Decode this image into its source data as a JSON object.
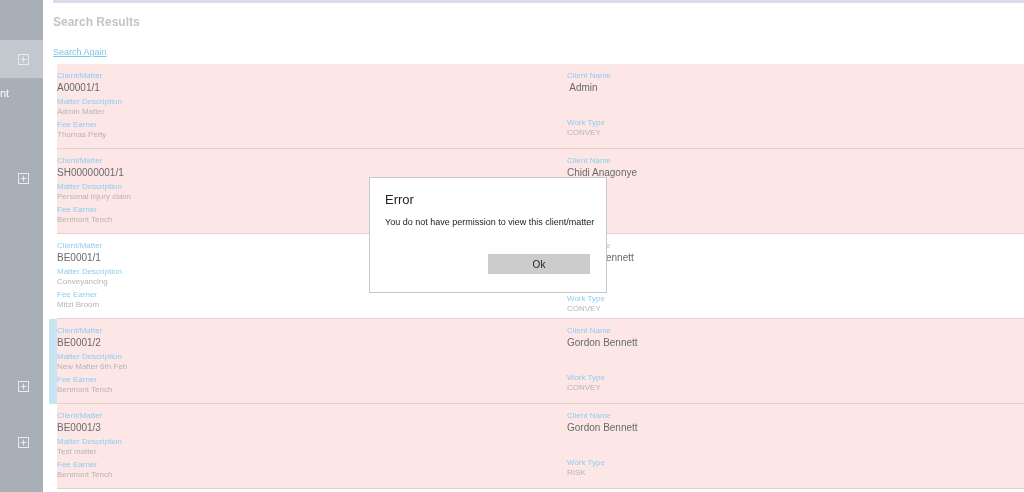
{
  "sidebar": {
    "items": [
      {
        "kind": "expander",
        "selected": true
      },
      {
        "kind": "text",
        "label": "nt"
      },
      {
        "kind": "expander",
        "selected": false
      },
      {
        "kind": "expander",
        "selected": false
      },
      {
        "kind": "expander",
        "selected": false
      }
    ]
  },
  "title": "Search Results",
  "search_again_link": "Search Again",
  "results": [
    {
      "selected": false,
      "highlighted": true,
      "partly_covered": false,
      "client_matter_label": "Client/Matter",
      "client_matter": "A00001/1",
      "matter_description_label": "Matter Description",
      "matter_description": "Admin Matter",
      "fee_earner_label": "Fee Earner",
      "fee_earner": "Thomas Petty",
      "client_name_label": "Client Name",
      "client_name": " Admin",
      "work_type_label": "Work Type",
      "work_type": "CONVEY"
    },
    {
      "selected": false,
      "highlighted": true,
      "partly_covered": false,
      "client_matter_label": "Client/Matter",
      "client_matter": "SH00000001/1",
      "matter_description_label": "Matter Description",
      "matter_description": "Personal injury claim",
      "fee_earner_label": "Fee Earner",
      "fee_earner": "Benmont Tench",
      "client_name_label": "Client Name",
      "client_name": "Chidi Anagonye"
    },
    {
      "selected": false,
      "highlighted": false,
      "partly_covered": true,
      "client_matter_label": "Client/Matter",
      "client_matter": "BE0001/1",
      "matter_description_label": "Matter Description",
      "matter_description": "Conveyancing",
      "fee_earner_label": "Fee Earner",
      "fee_earner": "Mitzi Broom",
      "client_name_label": "e",
      "client_name": "ennett",
      "work_type_label": "Work Type",
      "work_type": "CONVEY"
    },
    {
      "selected": true,
      "highlighted": true,
      "partly_covered": false,
      "client_matter_label": "Client/Matter",
      "client_matter": "BE0001/2",
      "matter_description_label": "Matter Description",
      "matter_description": "New Matter 6th Feb",
      "fee_earner_label": "Fee Earner",
      "fee_earner": "Benmont Tench",
      "client_name_label": "Client Name",
      "client_name": "Gordon Bennett",
      "work_type_label": "Work Type",
      "work_type": "CONVEY"
    },
    {
      "selected": false,
      "highlighted": true,
      "partly_covered": false,
      "client_matter_label": "Client/Matter",
      "client_matter": "BE0001/3",
      "matter_description_label": "Matter Description",
      "matter_description": "Test matter",
      "fee_earner_label": "Fee Earner",
      "fee_earner": "Benmont Tench",
      "client_name_label": "Client Name",
      "client_name": "Gordon Bennett",
      "work_type_label": "Work Type",
      "work_type": "RISK"
    }
  ],
  "dialog": {
    "title": "Error",
    "message": "You do not have permission to view this client/matter",
    "button": "Ok"
  }
}
